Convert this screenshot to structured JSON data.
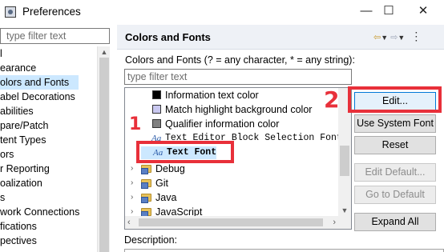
{
  "window": {
    "title": "Preferences",
    "minimize_glyph": "—",
    "maximize_glyph": "☐",
    "close_glyph": "✕"
  },
  "left": {
    "filter_placeholder": "type filter text",
    "items": [
      {
        "label": "l",
        "selected": false
      },
      {
        "label": "earance",
        "selected": false
      },
      {
        "label": "olors and Fonts",
        "selected": true
      },
      {
        "label": "abel Decorations",
        "selected": false
      },
      {
        "label": "abilities",
        "selected": false
      },
      {
        "label": "pare/Patch",
        "selected": false
      },
      {
        "label": "tent Types",
        "selected": false
      },
      {
        "label": "ors",
        "selected": false
      },
      {
        "label": "r Reporting",
        "selected": false
      },
      {
        "label": "oalization",
        "selected": false
      },
      {
        "label": "s",
        "selected": false
      },
      {
        "label": "work Connections",
        "selected": false
      },
      {
        "label": "fications",
        "selected": false
      },
      {
        "label": "pectives",
        "selected": false
      }
    ]
  },
  "page": {
    "title": "Colors and Fonts",
    "description": "Colors and Fonts (? = any character, * = any string):",
    "filter_placeholder": "type filter text",
    "description_label": "Description:"
  },
  "tree": {
    "color_rows": [
      {
        "label": "Information text color",
        "color": "#000000"
      },
      {
        "label": "Match highlight background color",
        "color": "#c9c8f0"
      },
      {
        "label": "Qualifier information color",
        "color": "#808080"
      }
    ],
    "font_rows": [
      {
        "label": "Text Editor Block Selection Font",
        "glyph": "Aa",
        "selected": false
      },
      {
        "label": "Text Font",
        "glyph": "Aa",
        "selected": true
      }
    ],
    "folders": [
      "Debug",
      "Git",
      "Java",
      "JavaScript"
    ]
  },
  "buttons": {
    "edit": "Edit...",
    "use_system_font": "Use System Font",
    "reset": "Reset",
    "edit_default": "Edit Default...",
    "go_to_default": "Go to Default",
    "expand_all": "Expand All"
  },
  "annotations": {
    "number_1": "1",
    "number_2": "2",
    "color": "#e8303a"
  }
}
